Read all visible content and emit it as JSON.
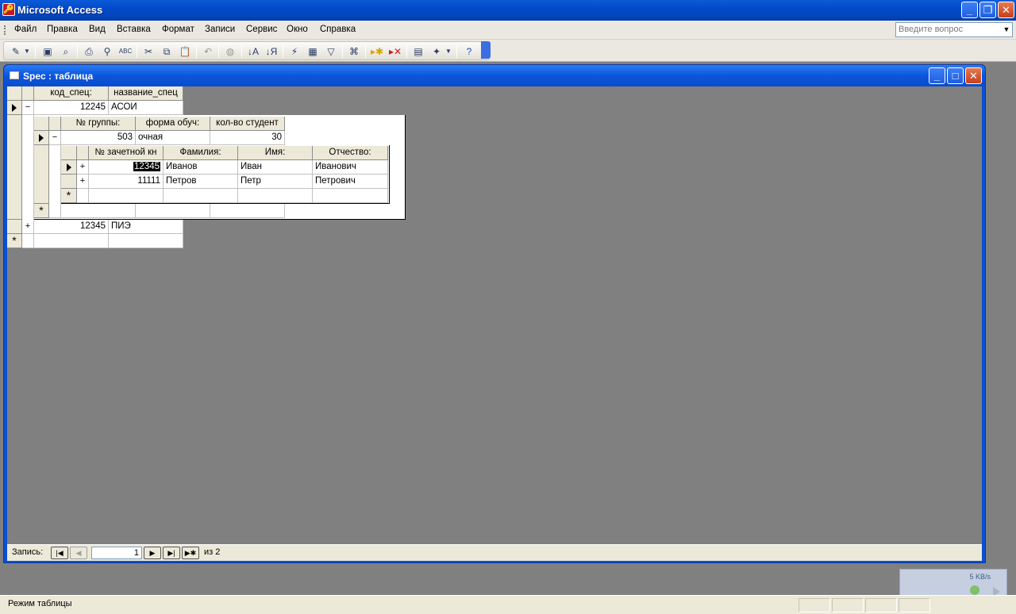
{
  "app": {
    "title": "Microsoft Access"
  },
  "menu": {
    "items": [
      "Файл",
      "Правка",
      "Вид",
      "Вставка",
      "Формат",
      "Записи",
      "Сервис",
      "Окно",
      "Справка"
    ],
    "help_placeholder": "Введите вопрос"
  },
  "toolbar": {
    "buttons": [
      "view-icon",
      "save-icon",
      "search-file-icon",
      "print-icon",
      "print-preview-icon",
      "spelling-icon",
      "cut-icon",
      "copy-icon",
      "paste-icon",
      "undo-icon",
      "hyperlink-icon",
      "sort-asc-icon",
      "sort-desc-icon",
      "filter-selection-icon",
      "filter-form-icon",
      "apply-filter-icon",
      "find-icon",
      "new-record-icon",
      "delete-record-icon",
      "properties-icon",
      "new-object-icon",
      "help-icon"
    ]
  },
  "window": {
    "title": "Spec : таблица"
  },
  "spec_table": {
    "columns": [
      "код_спец:",
      "название_спец"
    ],
    "rows": [
      {
        "code": "12245",
        "name": "АСОИ",
        "expander": "−"
      },
      {
        "code": "12345",
        "name": "ПИЭ",
        "expander": "+"
      }
    ],
    "new_row_marker": "*"
  },
  "group_table": {
    "columns": [
      "№ группы:",
      "форма обуч:",
      "кол-во студент"
    ],
    "rows": [
      {
        "group": "503",
        "form": "очная",
        "count": "30",
        "expander": "−"
      }
    ],
    "new_row_marker": "*"
  },
  "student_table": {
    "columns": [
      "№ зачетной кн",
      "Фамилия:",
      "Имя:",
      "Отчество:"
    ],
    "rows": [
      {
        "id": "12345",
        "last": "Иванов",
        "first": "Иван",
        "middle": "Иванович",
        "expander": "+"
      },
      {
        "id": "11111",
        "last": "Петров",
        "first": "Петр",
        "middle": "Петрович",
        "expander": "+"
      }
    ],
    "new_row_marker": "*"
  },
  "navigation": {
    "label": "Запись:",
    "current": "1",
    "of_label": "из  2"
  },
  "status": {
    "text": "Режим таблицы"
  },
  "widget": {
    "speed": "5 KB/s"
  }
}
